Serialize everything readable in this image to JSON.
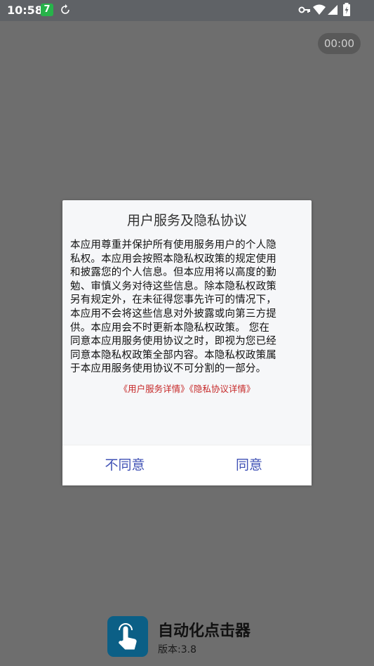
{
  "status_bar": {
    "time": "10:58",
    "app_badge": "7",
    "icons": [
      "sync-icon",
      "key-icon",
      "wifi-icon",
      "signal-icon",
      "battery-charging-icon"
    ]
  },
  "timer": "00:00",
  "dialog": {
    "title": "用户服务及隐私协议",
    "body_lines": [
      "本应用尊重并保护所有使用服务用户的个人隐",
      "私权。本应用会按照本隐私权政策的规定使用",
      "和披露您的个人信息。但本应用将以高度的勤",
      "勉、审慎义务对待这些信息。除本隐私权政策",
      "另有规定外，在未征得您事先许可的情况下，",
      "本应用不会将这些信息对外披露或向第三方提",
      "供。本应用会不时更新本隐私权政策。 您在",
      "同意本应用服务使用协议之时，即视为您已经",
      "同意本隐私权政策全部内容。本隐私权政策属",
      "于本应用服务使用协议不可分割的一部分。"
    ],
    "link_user_service": "《用户服务详情》",
    "link_privacy": "《隐私协议详情》",
    "disagree_label": "不同意",
    "agree_label": "同意"
  },
  "brand": {
    "name": "自动化点击器",
    "version": "版本:3.8",
    "icon": "tap-hand-icon"
  },
  "colors": {
    "overlay": "#6e6e6e",
    "button_text": "#3f51b5",
    "link_text": "#c62828",
    "brand_icon_bg": "#0b5f86"
  }
}
